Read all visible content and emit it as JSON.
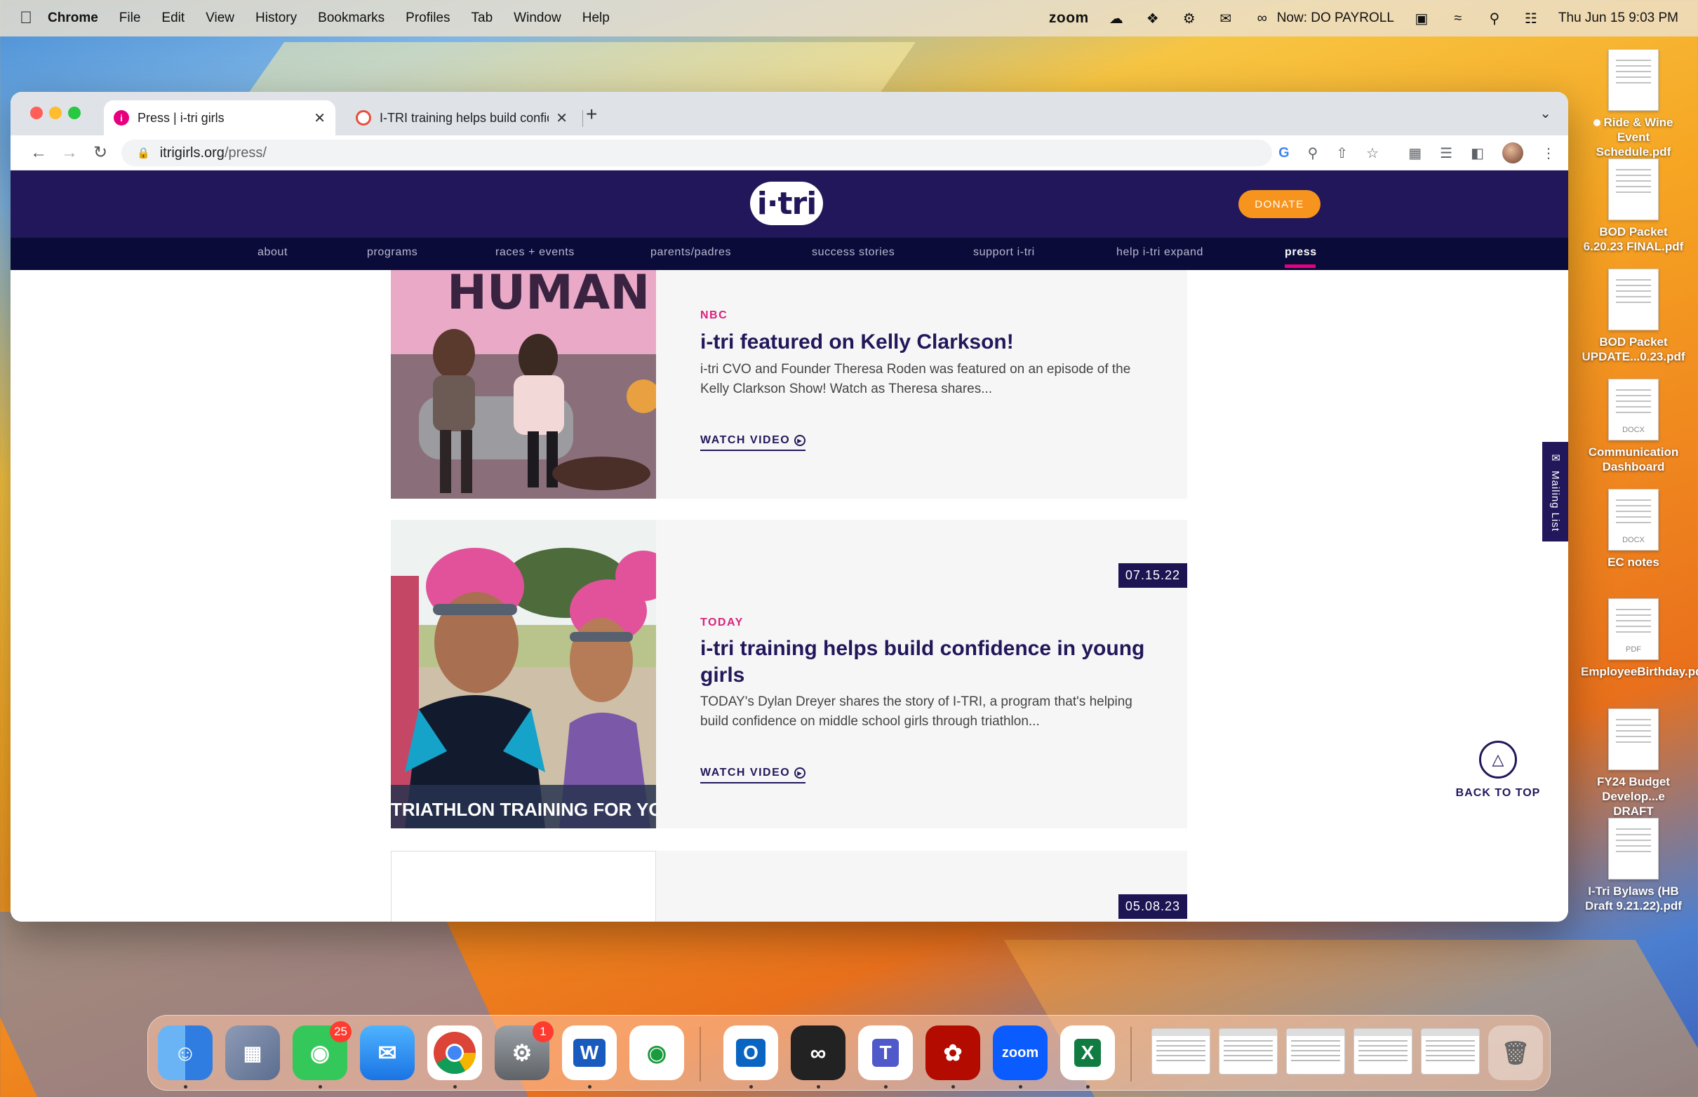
{
  "menubar": {
    "app": "Chrome",
    "items": [
      "File",
      "Edit",
      "View",
      "History",
      "Bookmarks",
      "Profiles",
      "Tab",
      "Window",
      "Help"
    ],
    "zoom": "zoom",
    "now_playing": "Now: DO PAYROLL",
    "datetime": "Thu Jun 15  9:03 PM"
  },
  "browser": {
    "tabs": [
      {
        "title": "Press | i-tri girls",
        "active": true
      },
      {
        "title": "I-TRI training helps build confidence",
        "active": false
      }
    ],
    "url": {
      "host": "itrigirls.org",
      "path": "/press/"
    }
  },
  "site": {
    "logo": "i·tri",
    "donate": "DONATE",
    "nav": [
      "about",
      "programs",
      "races + events",
      "parents/padres",
      "success stories",
      "support i-tri",
      "help i-tri expand",
      "press"
    ],
    "current_nav": "press",
    "cards": [
      {
        "source": "NBC",
        "title": "i-tri featured on Kelly Clarkson!",
        "description": "i-tri CVO and Founder Theresa Roden was featured on an episode of the Kelly Clarkson Show! Watch as Theresa shares...",
        "cta": "WATCH VIDEO",
        "image_text": "HUMAN"
      },
      {
        "date": "07.15.22",
        "source": "TODAY",
        "title": "i-tri training helps build confidence in young girls",
        "description": "TODAY's Dylan Dreyer shares the story of I-TRI, a program that's helping build confidence on middle school girls through triathlon...",
        "cta": "WATCH VIDEO",
        "image_text": "TRIATHLON TRAINING FOR YOUNG GIRLS"
      },
      {
        "date": "05.08.23"
      }
    ],
    "mailing_list": "Mailing List",
    "back_to_top": "BACK TO TOP"
  },
  "desktop_icons": [
    {
      "label": "Ride & Wine Event Schedule.pdf",
      "tag": ""
    },
    {
      "label": "BOD Packet 6.20.23 FINAL.pdf",
      "tag": ""
    },
    {
      "label": "BOD Packet UPDATE...0.23.pdf",
      "tag": ""
    },
    {
      "label": "Communication Dashboard",
      "tag": "DOCX"
    },
    {
      "label": "EC notes",
      "tag": "DOCX"
    },
    {
      "label": "EmployeeBirthday.pdf",
      "tag": "PDF"
    },
    {
      "label": "FY24 Budget Develop...e DRAFT",
      "tag": ""
    },
    {
      "label": "I-Tri Bylaws (HB Draft 9.21.22).pdf",
      "tag": ""
    }
  ],
  "dock": {
    "messages_badge": "25",
    "settings_badge": "1",
    "zoom_label": "zoom",
    "word_letter": "W",
    "outlook_letter": "O",
    "teams_letter": "T",
    "excel_letter": "X"
  },
  "colors": {
    "site_header": "#22175a",
    "site_nav": "#0b0b3a",
    "accent_pink": "#e6007e",
    "donate_orange": "#f7941d"
  }
}
